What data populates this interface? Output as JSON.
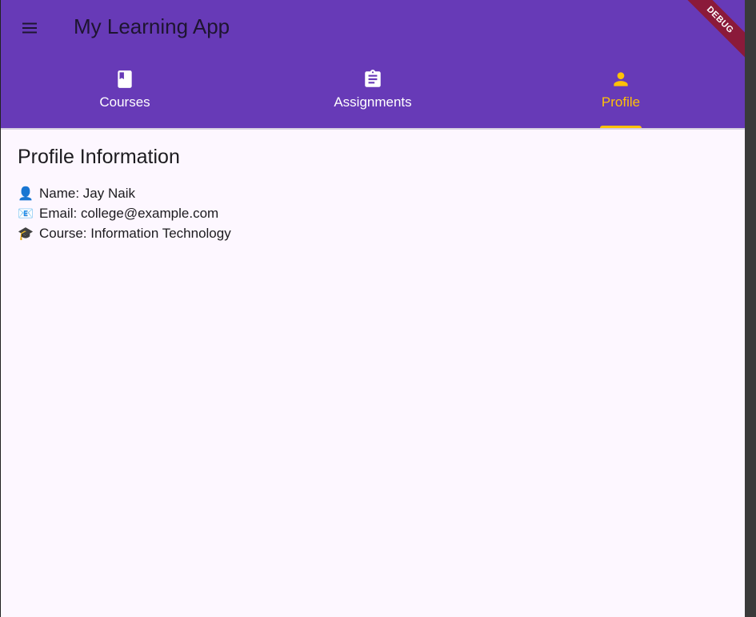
{
  "app": {
    "title": "My Learning App",
    "debug_banner": "DEBUG"
  },
  "tabs": [
    {
      "label": "Courses",
      "icon": "book-icon",
      "active": false
    },
    {
      "label": "Assignments",
      "icon": "assignment-icon",
      "active": false
    },
    {
      "label": "Profile",
      "icon": "person-icon",
      "active": true
    }
  ],
  "profile": {
    "heading": "Profile Information",
    "lines": [
      {
        "emoji": "👤",
        "icon": "person-emoji-icon",
        "text": "Name: Jay Naik"
      },
      {
        "emoji": "📧",
        "icon": "email-emoji-icon",
        "text": "Email: college@example.com"
      },
      {
        "emoji": "🎓",
        "icon": "graduation-cap-emoji-icon",
        "text": "Course: Information Technology"
      }
    ]
  },
  "colors": {
    "appbar": "#673ab7",
    "active_tab": "#ffc107",
    "background": "#fdf7ff",
    "debug_banner": "#8b1a3a"
  }
}
